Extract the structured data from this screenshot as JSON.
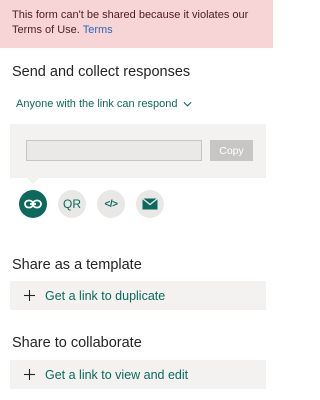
{
  "banner": {
    "message": "This form can't be shared because it violates our Terms of Use.",
    "link_label": "Terms"
  },
  "send": {
    "title": "Send and collect responses",
    "audience": "Anyone with the link can respond",
    "copy_label": "Copy",
    "link_value": "",
    "qr_label": "QR",
    "embed_label": "</>",
    "icons": [
      "link-icon",
      "qr-code",
      "embed-icon",
      "email-icon"
    ]
  },
  "template": {
    "title": "Share as a template",
    "action": "Get a link to duplicate"
  },
  "collaborate": {
    "title": "Share to collaborate",
    "action": "Get a link to view and edit"
  },
  "colors": {
    "accent": "#0b6a5b",
    "banner_bg": "#f7d4d6",
    "panel_bg": "#f3f2f1"
  }
}
